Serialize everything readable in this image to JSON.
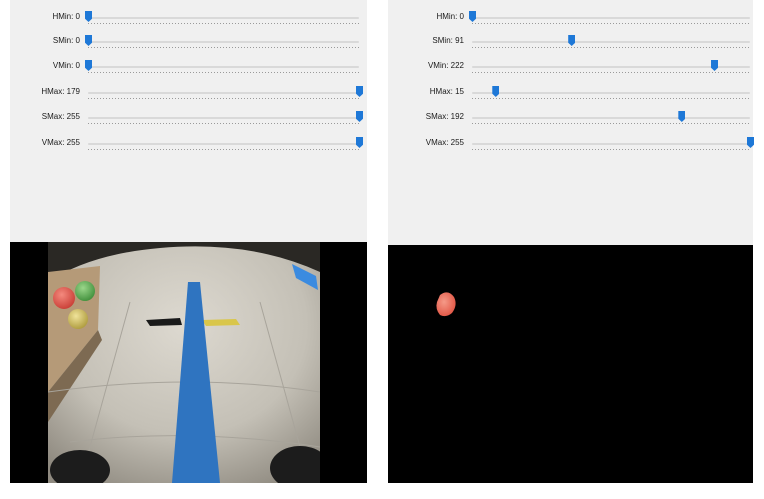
{
  "left_window": {
    "sliders": [
      {
        "label": "HMin: 0",
        "value": 0,
        "max": 255
      },
      {
        "label": "SMin: 0",
        "value": 0,
        "max": 255
      },
      {
        "label": "VMin: 0",
        "value": 0,
        "max": 255
      },
      {
        "label": "HMax: 179",
        "value": 179,
        "max": 179
      },
      {
        "label": "SMax: 255",
        "value": 255,
        "max": 255
      },
      {
        "label": "VMax: 255",
        "value": 255,
        "max": 255
      }
    ],
    "image": "camera-feed"
  },
  "right_window": {
    "sliders": [
      {
        "label": "HMin: 0",
        "value": 0,
        "max": 179
      },
      {
        "label": "SMin: 91",
        "value": 91,
        "max": 255
      },
      {
        "label": "VMin: 222",
        "value": 222,
        "max": 255
      },
      {
        "label": "HMax: 15",
        "value": 15,
        "max": 179
      },
      {
        "label": "SMax: 192",
        "value": 192,
        "max": 255
      },
      {
        "label": "VMax: 255",
        "value": 255,
        "max": 255
      }
    ],
    "image": "hsv-mask-output"
  },
  "colors": {
    "thumb": "#1e78d7",
    "panel": "#f0f0f0",
    "floor": "#c9c5bb",
    "tape": "#2f74c0",
    "red_ball": "#e8574d",
    "green_ball": "#66b35a",
    "yellow_ball": "#d6c461"
  }
}
